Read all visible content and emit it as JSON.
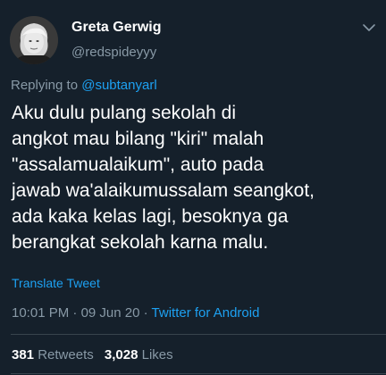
{
  "author": {
    "display_name": "Greta Gerwig",
    "handle": "@redspideyyy"
  },
  "reply": {
    "prefix": "Replying to",
    "mention": "@subtanyarl"
  },
  "tweet": {
    "lines": [
      "Aku dulu pulang sekolah di",
      "angkot mau bilang \"kiri\" malah",
      "\"assalamualaikum\", auto pada",
      "jawab wa'alaikumussalam seangkot,",
      "ada kaka kelas lagi, besoknya ga",
      "berangkat sekolah karna malu."
    ]
  },
  "translate_label": "Translate Tweet",
  "meta": {
    "time": "10:01 PM",
    "separator": "·",
    "date": "09 Jun 20",
    "source": "Twitter for Android"
  },
  "stats": {
    "retweets_count": "381",
    "retweets_label": "Retweets",
    "likes_count": "3,028",
    "likes_label": "Likes"
  },
  "icons": {
    "avatar": "avatar-photo",
    "menu": "chevron-down-icon"
  },
  "colors": {
    "background": "#15202b",
    "secondary_text": "#8899a6",
    "link": "#1da1f2",
    "divider": "#38444d"
  }
}
